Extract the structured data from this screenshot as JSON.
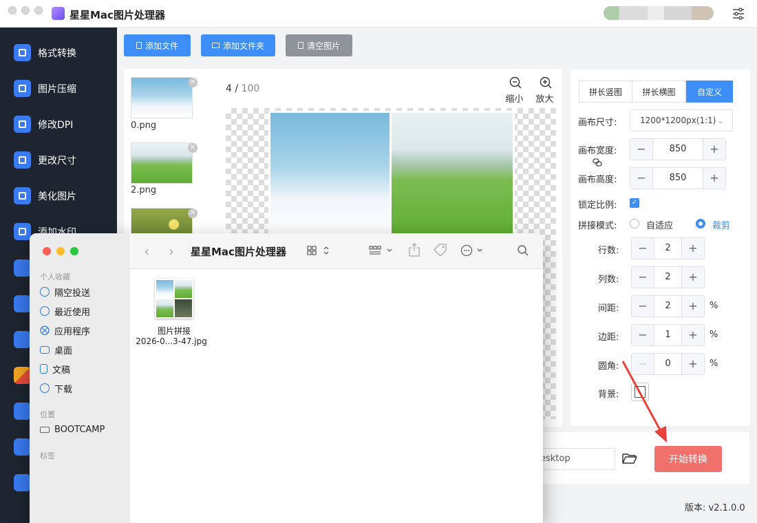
{
  "app": {
    "title": "星星Mac图片处理器"
  },
  "sidebar": {
    "items": [
      {
        "label": "格式转换",
        "icon": "format-convert-icon"
      },
      {
        "label": "图片压缩",
        "icon": "compress-icon"
      },
      {
        "label": "修改DPI",
        "icon": "dpi-icon"
      },
      {
        "label": "更改尺寸",
        "icon": "resize-icon"
      },
      {
        "label": "美化图片",
        "icon": "beautify-icon"
      },
      {
        "label": "添加水印",
        "icon": "watermark-icon"
      }
    ]
  },
  "toolbar": {
    "add_file": "添加文件",
    "add_folder": "添加文件夹",
    "clear": "清空图片"
  },
  "files": [
    {
      "name": "0.png"
    },
    {
      "name": "2.png"
    }
  ],
  "preview": {
    "current": "4",
    "separator": "/",
    "total": "100",
    "zoom_out": "缩小",
    "zoom_in": "放大"
  },
  "settings": {
    "tabs": [
      "拼长竖图",
      "拼长横图",
      "自定义"
    ],
    "active_tab": "自定义",
    "canvas_size_label": "画布尺寸:",
    "canvas_size_value": "1200*1200px(1:1)",
    "canvas_width_label": "画布宽度:",
    "canvas_width": "850",
    "canvas_height_label": "画布高度:",
    "canvas_height": "850",
    "lock_ratio_label": "锁定比例:",
    "lock_ratio": true,
    "mode_label": "拼接模式:",
    "mode_options": [
      "自适应",
      "裁剪"
    ],
    "mode_selected": "裁剪",
    "rows_label": "行数:",
    "rows": "2",
    "cols_label": "列数:",
    "cols": "2",
    "gap_label": "间距:",
    "gap": "2",
    "margin_label": "边距:",
    "margin": "1",
    "radius_label": "圆角:",
    "radius": "0",
    "percent": "%",
    "bg_label": "背景:",
    "minus": "−",
    "plus": "+"
  },
  "output": {
    "path_partial": "esktop",
    "start_button": "开始转换"
  },
  "version": "版本: v2.1.0.0",
  "finder": {
    "title": "星星Mac图片处理器",
    "favorites_heading": "个人收藏",
    "favorites": [
      {
        "label": "隔空投送",
        "icon": "airdrop-icon"
      },
      {
        "label": "最近使用",
        "icon": "recents-icon"
      },
      {
        "label": "应用程序",
        "icon": "applications-icon"
      },
      {
        "label": "桌面",
        "icon": "desktop-icon"
      },
      {
        "label": "文稿",
        "icon": "documents-icon"
      },
      {
        "label": "下载",
        "icon": "downloads-icon"
      }
    ],
    "locations_heading": "位置",
    "locations": [
      {
        "label": "BOOTCAMP",
        "icon": "drive-icon"
      }
    ],
    "tags_heading": "标签",
    "file_name_line1": "图片拼接",
    "file_name_line2": "2026-0...3-47.jpg"
  },
  "colors": {
    "accent_blue": "#3d8ef7",
    "start_button": "#f0716c",
    "sidebar_bg": "#1f2530",
    "arrow_red": "#e8413c"
  }
}
